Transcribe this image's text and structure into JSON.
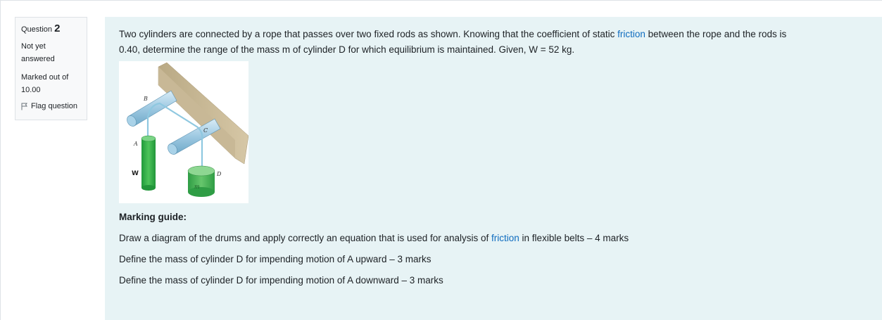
{
  "info": {
    "question_label": "Question",
    "question_number": "2",
    "state": "Not yet answered",
    "grade": "Marked out of 10.00",
    "flag_label": "Flag question"
  },
  "question": {
    "line1_before": "Two cylinders are connected by a rope that passes over two fixed rods as shown. Knowing that the coefficient of static ",
    "line1_link": "friction",
    "line1_after": " between the rope and the rods is",
    "line2": "0.40, determine the range of the mass m of cylinder D for which equilibrium is maintained. Given, W = 52 kg."
  },
  "figure": {
    "labels": {
      "a": "A",
      "b": "B",
      "c": "C",
      "d": "D",
      "w": "W",
      "m": "m"
    },
    "colors": {
      "wall": "#c8b896",
      "rod": "#9ec9e2",
      "cylinder_a": "#3cb54a",
      "cylinder_d": "#52b85a",
      "rope": "#8fc8e0"
    }
  },
  "marking_guide": {
    "title": "Marking guide:",
    "item1_before": "Draw a  diagram of the drums and apply correctly an equation that is used for analysis of ",
    "item1_link": "friction",
    "item1_after": " in flexible belts – 4 marks",
    "item2": "Define the mass of cylinder D for impending motion of A upward – 3 marks",
    "item3": "Define the mass of cylinder D for impending motion of A downward – 3 marks"
  }
}
